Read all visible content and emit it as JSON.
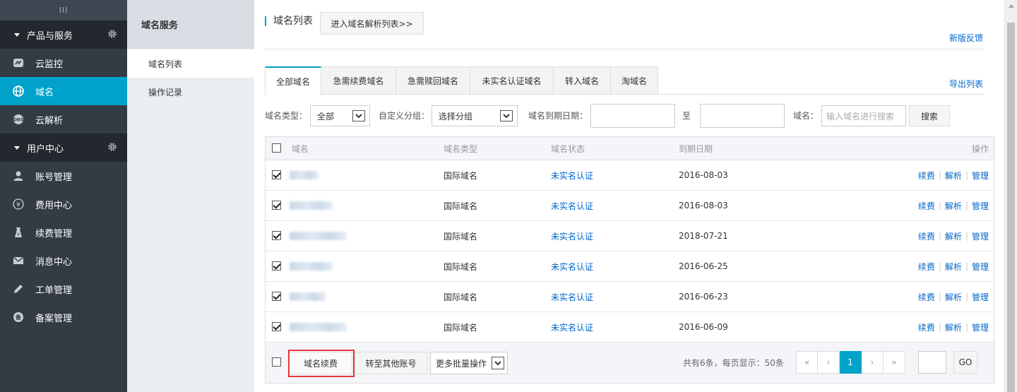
{
  "nav": {
    "collapse_glyph": "III",
    "group_products": "产品与服务",
    "items_products": [
      {
        "label": "云监控",
        "icon": "monitor-icon"
      },
      {
        "label": "域名",
        "icon": "globe-icon"
      },
      {
        "label": "云解析",
        "icon": "dns-icon"
      }
    ],
    "group_user": "用户中心",
    "items_user": [
      {
        "label": "账号管理",
        "icon": "user-icon"
      },
      {
        "label": "费用中心",
        "icon": "yen-icon"
      },
      {
        "label": "续费管理",
        "icon": "renew-icon"
      },
      {
        "label": "消息中心",
        "icon": "mail-icon"
      },
      {
        "label": "工单管理",
        "icon": "pencil-icon"
      },
      {
        "label": "备案管理",
        "icon": "record-icon"
      }
    ]
  },
  "subnav": {
    "title": "域名服务",
    "items": [
      "域名列表",
      "操作记录"
    ]
  },
  "header": {
    "title": "域名列表",
    "enter_dns_btn": "进入域名解析列表>>",
    "feedback": "新版反馈"
  },
  "tabs": [
    "全部域名",
    "急需续费域名",
    "急需赎回域名",
    "未实名认证域名",
    "转入域名",
    "淘域名"
  ],
  "export_link": "导出列表",
  "filters": {
    "type_label": "域名类型：",
    "type_value": "全部",
    "group_label": "自定义分组：",
    "group_value": "选择分组",
    "expire_label": "域名到期日期：",
    "to_label": "至",
    "domain_label": "域名：",
    "domain_placeholder": "输入域名进行搜索",
    "search_btn": "搜索"
  },
  "table": {
    "columns": [
      "域名",
      "域名类型",
      "域名状态",
      "到期日期",
      "操作"
    ],
    "rows": [
      {
        "type": "国际域名",
        "status": "未实名认证",
        "expire": "2016-08-03",
        "checked": true
      },
      {
        "type": "国际域名",
        "status": "未实名认证",
        "expire": "2016-08-03",
        "checked": true
      },
      {
        "type": "国际域名",
        "status": "未实名认证",
        "expire": "2018-07-21",
        "checked": true
      },
      {
        "type": "国际域名",
        "status": "未实名认证",
        "expire": "2016-06-25",
        "checked": true
      },
      {
        "type": "国际域名",
        "status": "未实名认证",
        "expire": "2016-06-23",
        "checked": true
      },
      {
        "type": "国际域名",
        "status": "未实名认证",
        "expire": "2016-06-09",
        "checked": true
      }
    ],
    "ops": [
      "续费",
      "解析",
      "管理"
    ]
  },
  "footer": {
    "renew_btn": "域名续费",
    "transfer_btn": "转至其他账号",
    "batch_select": "更多批量操作",
    "page_info": "共有6条，每页显示：50条",
    "pager": [
      "«",
      "‹",
      "1",
      "›",
      "»"
    ],
    "go_btn": "GO"
  },
  "colors": {
    "accent": "#00a2ca",
    "link": "#0066cc",
    "highlight": "#e4393c"
  }
}
